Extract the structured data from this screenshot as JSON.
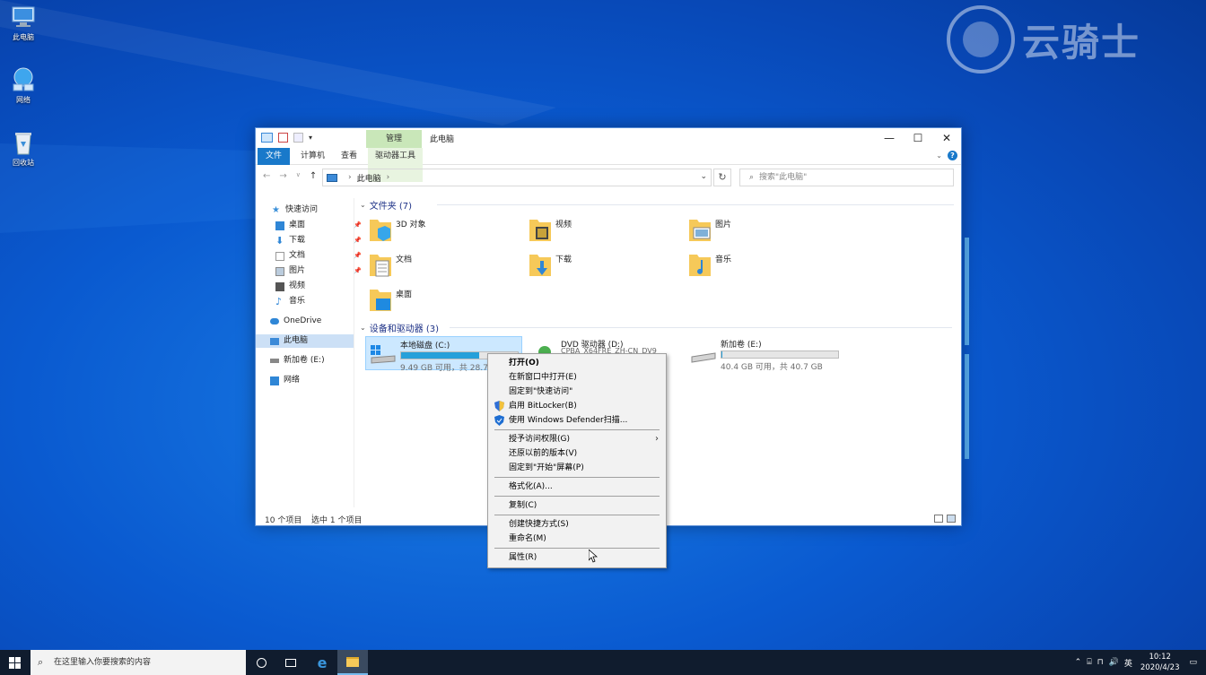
{
  "desktop": {
    "icons": [
      {
        "label": "此电脑",
        "icon": "this-pc-icon"
      },
      {
        "label": "网络",
        "icon": "network-icon"
      },
      {
        "label": "回收站",
        "icon": "recycle-bin-icon"
      }
    ],
    "watermark": "云骑士"
  },
  "window": {
    "title": "此电脑",
    "manage_tab": "管理",
    "ribbon_tabs": [
      "文件",
      "计算机",
      "查看",
      "驱动器工具"
    ],
    "controls": {
      "minimize": "—",
      "maximize": "☐",
      "close": "✕"
    },
    "help": "?",
    "address": {
      "crumb": "此电脑",
      "sep": "›"
    },
    "search_placeholder": "搜索\"此电脑\"",
    "nav": {
      "quick_access": "快速访问",
      "items": [
        "桌面",
        "下载",
        "文档",
        "图片",
        "视频",
        "音乐"
      ],
      "onedrive": "OneDrive",
      "this_pc": "此电脑",
      "new_volume": "新加卷 (E:)",
      "network": "网络"
    },
    "folders_header": "文件夹 (7)",
    "folders": [
      "3D 对象",
      "视频",
      "图片",
      "文档",
      "下载",
      "音乐",
      "桌面"
    ],
    "devices_header": "设备和驱动器 (3)",
    "drives": [
      {
        "name": "本地磁盘 (C:)",
        "free": "9.49 GB 可用，共 28.7 G",
        "usage": 0.67
      },
      {
        "name": "DVD 驱动器 (D:)",
        "sub": "CPBA_X64FRE_ZH-CN_DV9"
      },
      {
        "name": "新加卷 (E:)",
        "free": "40.4 GB 可用，共 40.7 GB",
        "usage": 0.01
      }
    ],
    "status": {
      "count": "10 个项目",
      "selected": "选中 1 个项目"
    }
  },
  "context_menu": {
    "items": [
      "打开(O)",
      "在新窗口中打开(E)",
      "固定到\"快速访问\"",
      "启用 BitLocker(B)",
      "使用 Windows Defender扫描...",
      "授予访问权限(G)",
      "还原以前的版本(V)",
      "固定到\"开始\"屏幕(P)",
      "格式化(A)...",
      "复制(C)",
      "创建快捷方式(S)",
      "重命名(M)",
      "属性(R)"
    ]
  },
  "taskbar": {
    "search_placeholder": "在这里输入你要搜索的内容",
    "tray_lang": "英",
    "time": "10:12",
    "date": "2020/4/23"
  },
  "colors": {
    "accent": "#1979ca",
    "selection": "#cce8ff",
    "drive_bar": "#26a0da",
    "manage": "#c9e7b9"
  }
}
